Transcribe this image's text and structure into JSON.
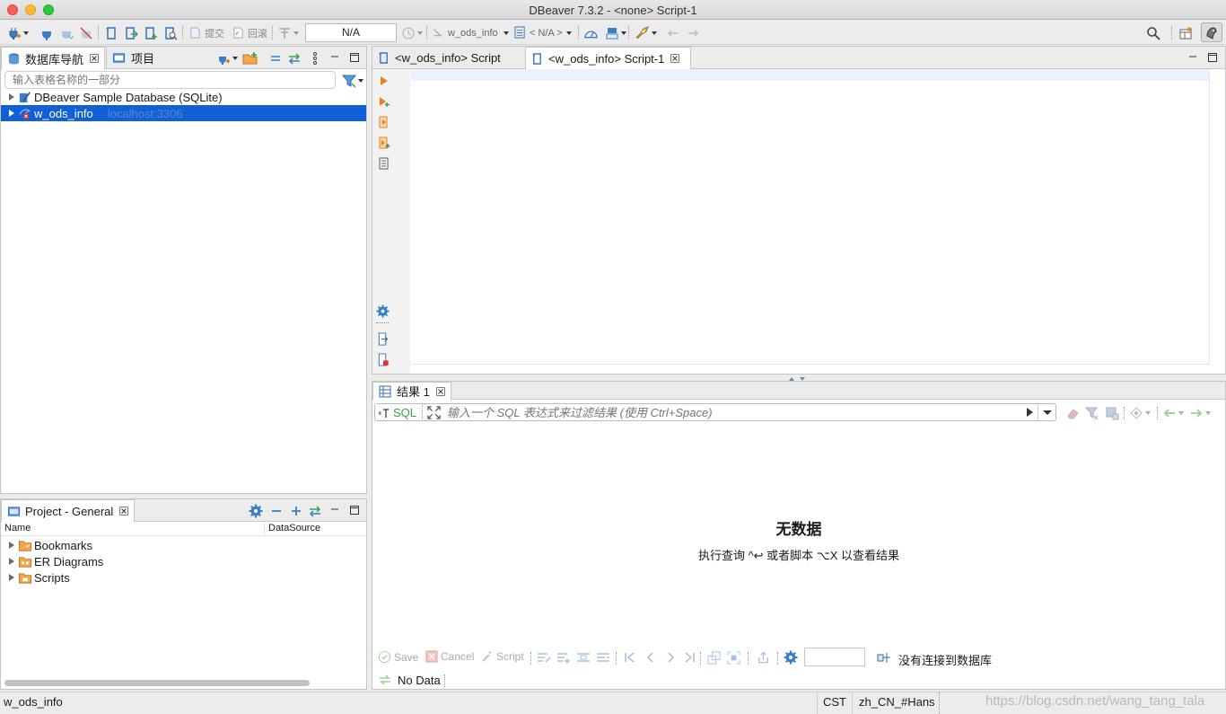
{
  "window": {
    "title": "DBeaver 7.3.2 - <none> Script-1"
  },
  "toolbar": {
    "commit_label": "提交",
    "rollback_label": "回滚",
    "transaction_value": "N/A",
    "datasource_label": "w_ods_info",
    "schema_label": "< N/A >"
  },
  "navigator": {
    "tab_db": "数据库导航",
    "tab_projects": "项目",
    "filter_placeholder": "输入表格名称的一部分",
    "items": [
      {
        "label": "DBeaver Sample Database (SQLite)",
        "sub": ""
      },
      {
        "label": "w_ods_info",
        "sub": "localhost:3306"
      }
    ]
  },
  "project": {
    "tab_label": "Project - General",
    "col_name": "Name",
    "col_datasource": "DataSource",
    "items": [
      {
        "label": "Bookmarks"
      },
      {
        "label": "ER Diagrams"
      },
      {
        "label": "Scripts"
      }
    ]
  },
  "editor": {
    "tabs": [
      {
        "label": "<w_ods_info> Script"
      },
      {
        "label": "<w_ods_info> Script-1"
      }
    ]
  },
  "results": {
    "tab_label": "结果 1",
    "sql_label": "SQL",
    "filter_placeholder": "输入一个 SQL 表达式来过滤结果 (使用 Ctrl+Space)",
    "empty_title": "无数据",
    "empty_hint": "执行查询 ^↩ 或者脚本 ⌥X 以查看结果",
    "save_label": "Save",
    "cancel_label": "Cancel",
    "script_label": "Script",
    "no_connection": "没有连接到数据库",
    "no_data": "No Data"
  },
  "statusbar": {
    "left": "w_ods_info",
    "timezone": "CST",
    "locale": "zh_CN_#Hans",
    "watermark": "https://blog.csdn.net/wang_tang_tala"
  },
  "colors": {
    "selection": "#1160d8",
    "accent_orange": "#e8831c",
    "accent_green": "#3aa04a",
    "accent_blue": "#3a7fc8"
  }
}
